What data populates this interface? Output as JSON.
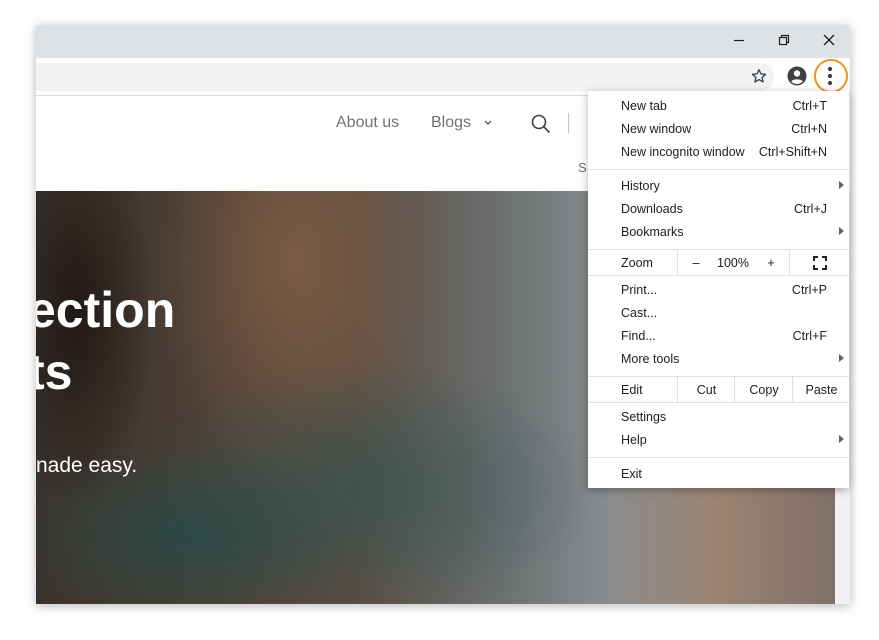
{
  "browser": {
    "window_controls": {
      "minimize": "minimize-icon",
      "restore": "restore-icon",
      "close": "close-icon"
    },
    "toolbar_icons": [
      "star-icon",
      "account-icon",
      "more-vert-icon"
    ],
    "highlight_color": "#f29221"
  },
  "site": {
    "nav": {
      "about": "About us",
      "blogs": "Blogs",
      "cutoff_letter": "S"
    },
    "hero": {
      "line1": "ection",
      "line2": "ts",
      "subtitle": "nade easy."
    }
  },
  "menu": {
    "new_tab": {
      "label": "New tab",
      "shortcut": "Ctrl+T"
    },
    "new_window": {
      "label": "New window",
      "shortcut": "Ctrl+N"
    },
    "new_incognito": {
      "label": "New incognito window",
      "shortcut": "Ctrl+Shift+N"
    },
    "history": {
      "label": "History"
    },
    "downloads": {
      "label": "Downloads",
      "shortcut": "Ctrl+J"
    },
    "bookmarks": {
      "label": "Bookmarks"
    },
    "zoom": {
      "label": "Zoom",
      "minus": "–",
      "value": "100%",
      "plus": "+"
    },
    "print": {
      "label": "Print...",
      "shortcut": "Ctrl+P"
    },
    "cast": {
      "label": "Cast..."
    },
    "find": {
      "label": "Find...",
      "shortcut": "Ctrl+F"
    },
    "more_tools": {
      "label": "More tools"
    },
    "edit": {
      "label": "Edit",
      "cut": "Cut",
      "copy": "Copy",
      "paste": "Paste"
    },
    "settings": {
      "label": "Settings"
    },
    "help": {
      "label": "Help"
    },
    "exit": {
      "label": "Exit"
    }
  }
}
